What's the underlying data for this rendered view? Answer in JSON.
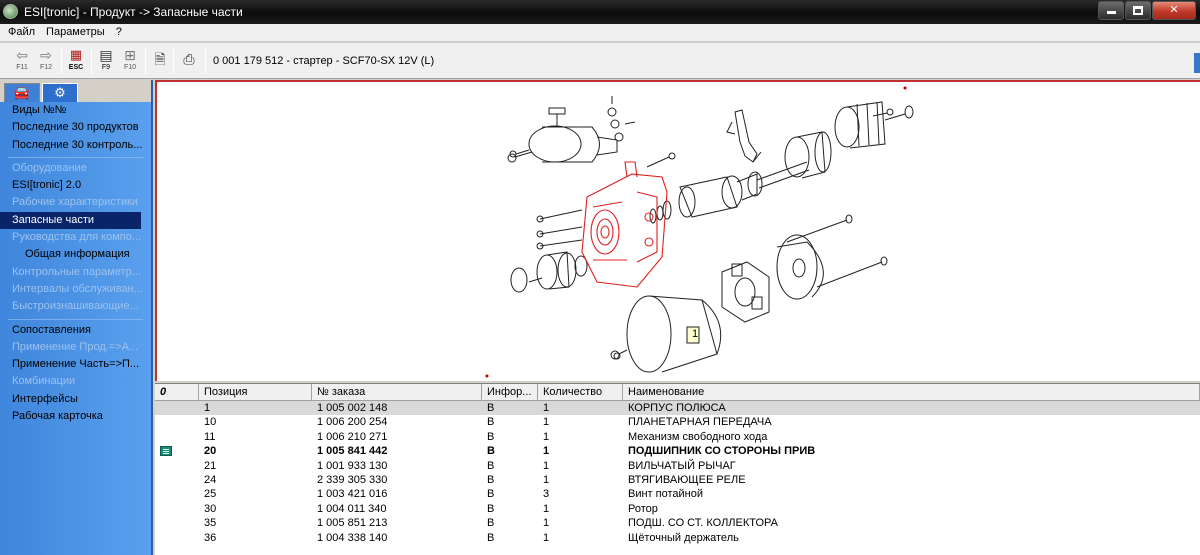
{
  "window": {
    "title": "ESI[tronic] - Продукт -> Запасные части"
  },
  "menu": {
    "items": [
      "Файл",
      "Параметры",
      "?"
    ]
  },
  "toolbar": {
    "buttons": [
      {
        "name": "back",
        "icon": "arrow-left-icon",
        "label": "F11"
      },
      {
        "name": "forward",
        "icon": "arrow-right-icon",
        "label": "F12"
      },
      {
        "name": "esc",
        "icon": "esc-icon",
        "label": "ESC"
      },
      {
        "name": "f9",
        "icon": "list-icon",
        "label": "F9"
      },
      {
        "name": "f10",
        "icon": "tree-icon",
        "label": "F10"
      },
      {
        "name": "document",
        "icon": "document-icon",
        "label": ""
      },
      {
        "name": "print",
        "icon": "printer-icon",
        "label": ""
      }
    ],
    "product": "0 001 179 512 - стартер - SCF70-SX 12V (L)"
  },
  "sidebar": {
    "items": [
      {
        "label": "Виды №№",
        "state": "normal"
      },
      {
        "label": "Последние 30 продуктов",
        "state": "normal"
      },
      {
        "label": "Последние 30 контроль...",
        "state": "normal"
      },
      {
        "label": "Оборудование",
        "state": "disabled"
      },
      {
        "label": "ESI[tronic] 2.0",
        "state": "normal"
      },
      {
        "label": "Рабочие характеристики",
        "state": "disabled"
      },
      {
        "label": "Запасные части",
        "state": "selected"
      },
      {
        "label": "Руководства для компо...",
        "state": "disabled"
      },
      {
        "label": "Общая информация",
        "state": "indent"
      },
      {
        "label": "Контрольные параметр...",
        "state": "disabled"
      },
      {
        "label": "Интервалы обслуживан...",
        "state": "disabled"
      },
      {
        "label": "Быстроизнашивающие...",
        "state": "disabled"
      },
      {
        "label": "Сопоставления",
        "state": "normal"
      },
      {
        "label": "Применение Прод.=>А...",
        "state": "disabled"
      },
      {
        "label": "Применение Часть=>П...",
        "state": "normal"
      },
      {
        "label": "Комбинации",
        "state": "disabled"
      },
      {
        "label": "Интерфейсы",
        "state": "normal"
      },
      {
        "label": "Рабочая карточка",
        "state": "normal"
      }
    ]
  },
  "drawing": {
    "callout": "1"
  },
  "table": {
    "columns": [
      "0",
      "Позиция",
      "№ заказа",
      "Инфор...",
      "Количество",
      "Наименование"
    ],
    "rows": [
      {
        "pos": "1",
        "order": "1 005 002 148",
        "info": "B",
        "qty": "1",
        "name": "КОРПУС ПОЛЮСА",
        "selected": true
      },
      {
        "pos": "10",
        "order": "1 006 200 254",
        "info": "B",
        "qty": "1",
        "name": "ПЛАНЕТАРНАЯ ПЕРЕДАЧА"
      },
      {
        "pos": "11",
        "order": "1 006 210 271",
        "info": "B",
        "qty": "1",
        "name": "Механизм свободного хода"
      },
      {
        "pos": "20",
        "order": "1 005 841 442",
        "info": "B",
        "qty": "1",
        "name": "ПОДШИПНИК СО СТОРОНЫ ПРИВ",
        "bold": true,
        "marker": true
      },
      {
        "pos": "21",
        "order": "1 001 933 130",
        "info": "B",
        "qty": "1",
        "name": "ВИЛЬЧАТЫЙ РЫЧАГ"
      },
      {
        "pos": "24",
        "order": "2 339 305 330",
        "info": "B",
        "qty": "1",
        "name": "ВТЯГИВАЮЩЕЕ РЕЛЕ"
      },
      {
        "pos": "25",
        "order": "1 003 421 016",
        "info": "B",
        "qty": "3",
        "name": "Винт потайной"
      },
      {
        "pos": "30",
        "order": "1 004 011 340",
        "info": "B",
        "qty": "1",
        "name": "Ротор"
      },
      {
        "pos": "35",
        "order": "1 005 851 213",
        "info": "B",
        "qty": "1",
        "name": "ПОДШ. СО СТ. КОЛЛЕКТОРА"
      },
      {
        "pos": "36",
        "order": "1 004 338 140",
        "info": "B",
        "qty": "1",
        "name": "Щёточный держатель"
      }
    ]
  },
  "colors": {
    "highlight_part": "#e02020",
    "sidebar_bg": "#4a90e2",
    "selected_nav": "#0a246a"
  }
}
